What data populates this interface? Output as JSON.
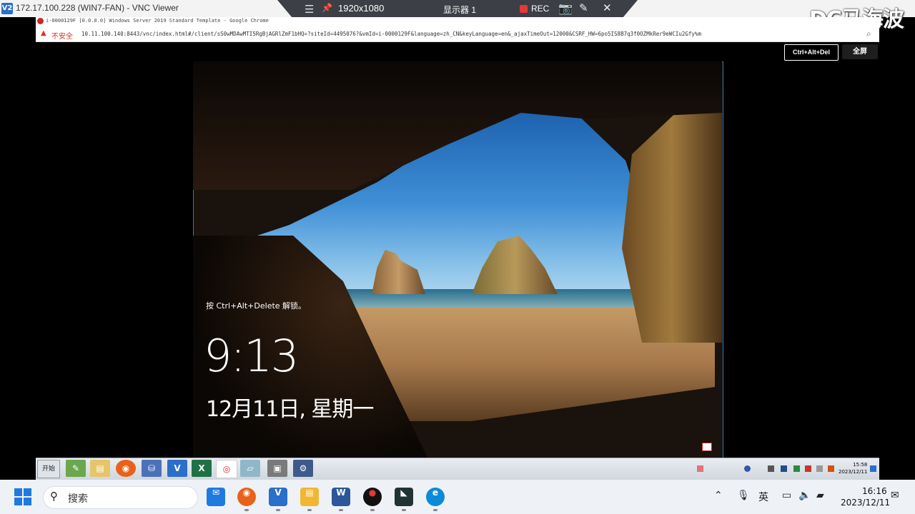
{
  "vnc": {
    "logo": "V2",
    "window_title": "172.17.100.228 (WIN7-FAN) - VNC Viewer",
    "toolbar": {
      "resolution": "1920x1080",
      "display": "显示器 1",
      "rec": "REC",
      "icons": [
        "menu-icon",
        "pin-icon",
        "camera-icon",
        "pen-icon",
        "close-icon"
      ]
    }
  },
  "watermark": "DC马海波",
  "chrome": {
    "tab_title": "i-0000129F [0.0.0.0] Windows Server 2019 Standard Template - Google Chrome",
    "security_label": "不安全",
    "url": "10.11.100.140:8443/vnc/index.html#/client/sS0wMDAwMTI5RgBjAGRlZmF1bHQ=?siteId=4495076?&vmId=i-0000129F&language=zh_CN&keyLanguage=en&_ajaxTimeOut=12000&CSRF_HW=6po5IS8B7q3f0OZMkRer9eWCIu2Gfy%m"
  },
  "vnc_buttons": {
    "ctrl_alt_del": "Ctrl+Alt+Del",
    "fullscreen": "全屏"
  },
  "lockscreen": {
    "hint": "按 Ctrl+Alt+Delete 解锁。",
    "time": "9:13",
    "date": "12月11日, 星期一"
  },
  "remote_taskbar": {
    "start_label": "开始",
    "tray_time": "15:58",
    "tray_date": "2023/12/11",
    "apps": [
      "paint",
      "folder",
      "firefox",
      "network",
      "vnc",
      "excel",
      "chrome",
      "disk",
      "computer",
      "settings"
    ]
  },
  "host_taskbar": {
    "search_placeholder": "搜索",
    "apps": [
      "mail",
      "firefox",
      "vnc",
      "file-explorer",
      "word",
      "recorder",
      "cat",
      "edge"
    ],
    "ime": "英",
    "time": "16:16",
    "date": "2023/12/11"
  },
  "colors": {
    "accent": "#1f7ae0",
    "rec_red": "#e53935",
    "warning_red": "#d93025"
  }
}
